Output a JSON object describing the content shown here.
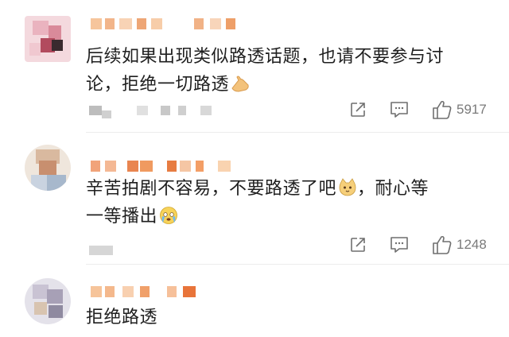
{
  "comments": [
    {
      "text_line1": "后续如果出现类似路透话题，也请不要参与讨",
      "text_line2": "论，拒绝一切路透",
      "emoji": "hand-icon",
      "likes": "5917"
    },
    {
      "text_line1": "辛苦拍剧不容易，不要路透了吧",
      "text_line1b": "，耐心等",
      "text_line2": "一等播出",
      "emoji1": "cat-face-icon",
      "emoji2": "crying-face-icon",
      "likes": "1248"
    },
    {
      "text_line1": "拒绝路透"
    }
  ]
}
